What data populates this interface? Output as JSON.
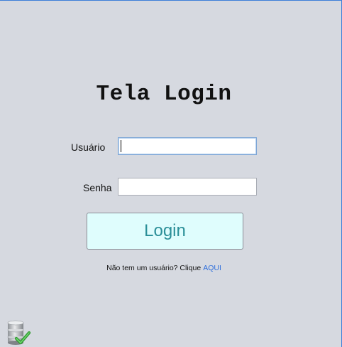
{
  "title": "Tela Login",
  "form": {
    "user_label": "Usuário",
    "user_value": "",
    "password_label": "Senha",
    "password_value": "",
    "login_label": "Login"
  },
  "signup": {
    "prompt": "Não tem um usuário? Clique",
    "link": "AQUI"
  },
  "icons": {
    "status": "database-check-icon"
  },
  "colors": {
    "background": "#d6d9e0",
    "button_bg": "#dffdfd",
    "button_text": "#2b8f98",
    "link": "#2f6fdc"
  }
}
